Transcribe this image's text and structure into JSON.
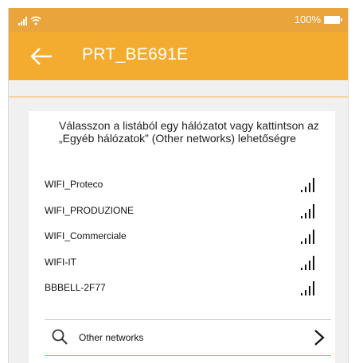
{
  "status_bar": {
    "battery_percent": "100%",
    "icons": [
      "signal-icon",
      "wifi-icon",
      "battery-icon"
    ]
  },
  "app_bar": {
    "title": "PRT_BE691E",
    "back_icon": "back-arrow-icon"
  },
  "instructions": "Válasszon a listából egy hálózatot vagy kattintson az „Egyéb hálózatok” (Other networks) lehetőségre",
  "networks": [
    {
      "name": "WIFI_Proteco",
      "signal_icon": "wifi-signal-icon"
    },
    {
      "name": "WIFI_PRODUZIONE",
      "signal_icon": "wifi-signal-icon"
    },
    {
      "name": "WIFI_Commerciale",
      "signal_icon": "wifi-signal-icon"
    },
    {
      "name": "WIFI-IT",
      "signal_icon": "wifi-signal-icon"
    },
    {
      "name": "BBBELL-2F77",
      "signal_icon": "wifi-signal-icon"
    }
  ],
  "other_networks": {
    "label": "Other networks",
    "icon": "search-icon",
    "chevron": "chevron-right-icon"
  },
  "colors": {
    "app_bar": "#f3ac30",
    "status_bar": "#e9a43c",
    "accent_divider": "#f0a43a",
    "background": "#eff0ef"
  }
}
